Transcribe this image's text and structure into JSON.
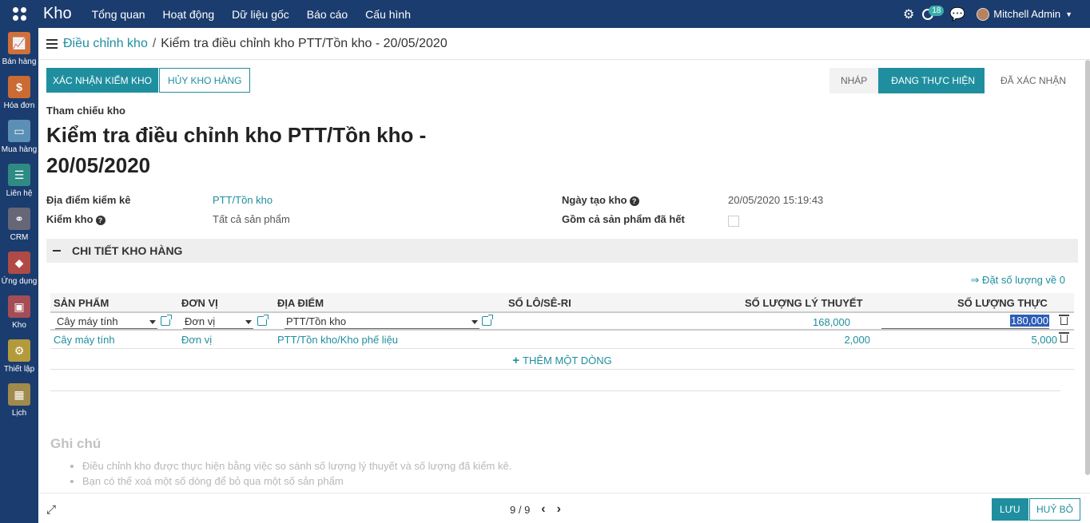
{
  "app": {
    "brand": "Kho",
    "menu": [
      "Tổng quan",
      "Hoạt động",
      "Dữ liệu gốc",
      "Báo cáo",
      "Cấu hình"
    ],
    "activity_count": "18",
    "user": "Mitchell Admin"
  },
  "sidebar": [
    {
      "label": "Bán hàng",
      "icon": "sales-icon",
      "color": "#d0703c"
    },
    {
      "label": "Hóa đơn",
      "icon": "invoice-icon",
      "color": "#c96b33"
    },
    {
      "label": "Mua hàng",
      "icon": "purchase-icon",
      "color": "#5b8fb5"
    },
    {
      "label": "Liên hệ",
      "icon": "contacts-icon",
      "color": "#2e8b84"
    },
    {
      "label": "CRM",
      "icon": "crm-icon",
      "color": "#666677"
    },
    {
      "label": "Ứng dụng",
      "icon": "apps-icon",
      "color": "#b04a46"
    },
    {
      "label": "Kho",
      "icon": "inventory-icon",
      "color": "#a54d55"
    },
    {
      "label": "Thiết lập",
      "icon": "settings-icon",
      "color": "#b39a3c"
    },
    {
      "label": "Lịch",
      "icon": "calendar-icon",
      "color": "#a08a4c"
    }
  ],
  "breadcrumb": {
    "parent": "Điều chỉnh kho",
    "separator": "/",
    "current": "Kiểm tra điều chỉnh kho PTT/Tồn kho - 20/05/2020"
  },
  "statusbar": {
    "validate": "XÁC NHẬN KIỂM KHO",
    "cancel": "HỦY KHO HÀNG",
    "stages": [
      "NHÁP",
      "ĐANG THỰC HIỆN",
      "ĐÃ XÁC NHẬN"
    ]
  },
  "form": {
    "ref_label": "Tham chiếu kho",
    "title": "Kiểm tra điều chỉnh kho PTT/Tồn kho - 20/05/2020",
    "location_label": "Địa điểm kiểm kê",
    "location_value": "PTT/Tồn kho",
    "inventory_label": "Kiểm kho",
    "inventory_value": "Tất cả sản phẩm",
    "date_label": "Ngày tạo kho",
    "date_value": "20/05/2020 15:19:43",
    "exhausted_label": "Gồm cả sản phẩm đã hết"
  },
  "section": {
    "title": "CHI TIẾT KHO HÀNG",
    "reset": "⇒ Đặt số lượng về 0"
  },
  "table": {
    "headers": [
      "SẢN PHẨM",
      "ĐƠN VỊ",
      "ĐỊA ĐIỂM",
      "SỐ LÔ/SÊ-RI",
      "SỐ LƯỢNG LÝ THUYẾT",
      "SỐ LƯỢNG THỰC"
    ],
    "rows": [
      {
        "product": "Cây máy tính",
        "uom": "Đơn vị",
        "location": "PTT/Tồn kho",
        "lot": "",
        "theoretical": "168,000",
        "real": "180,000"
      },
      {
        "product": "Cây máy tính",
        "uom": "Đơn vị",
        "location": "PTT/Tồn kho/Kho phế liệu",
        "lot": "",
        "theoretical": "2,000",
        "real": "5,000"
      }
    ],
    "add_line": "THÊM MỘT DÒNG"
  },
  "notes": {
    "title": "Ghi chú",
    "items": [
      "Điều chỉnh kho được thực hiện bằng việc so sánh số lượng lý thuyết và số lượng đã kiểm kê.",
      "Bạn có thể xoá một số dòng để bỏ qua một số sản phẩm"
    ]
  },
  "footer": {
    "pager": "9 / 9",
    "save": "LƯU",
    "discard": "HUỶ BỎ"
  }
}
